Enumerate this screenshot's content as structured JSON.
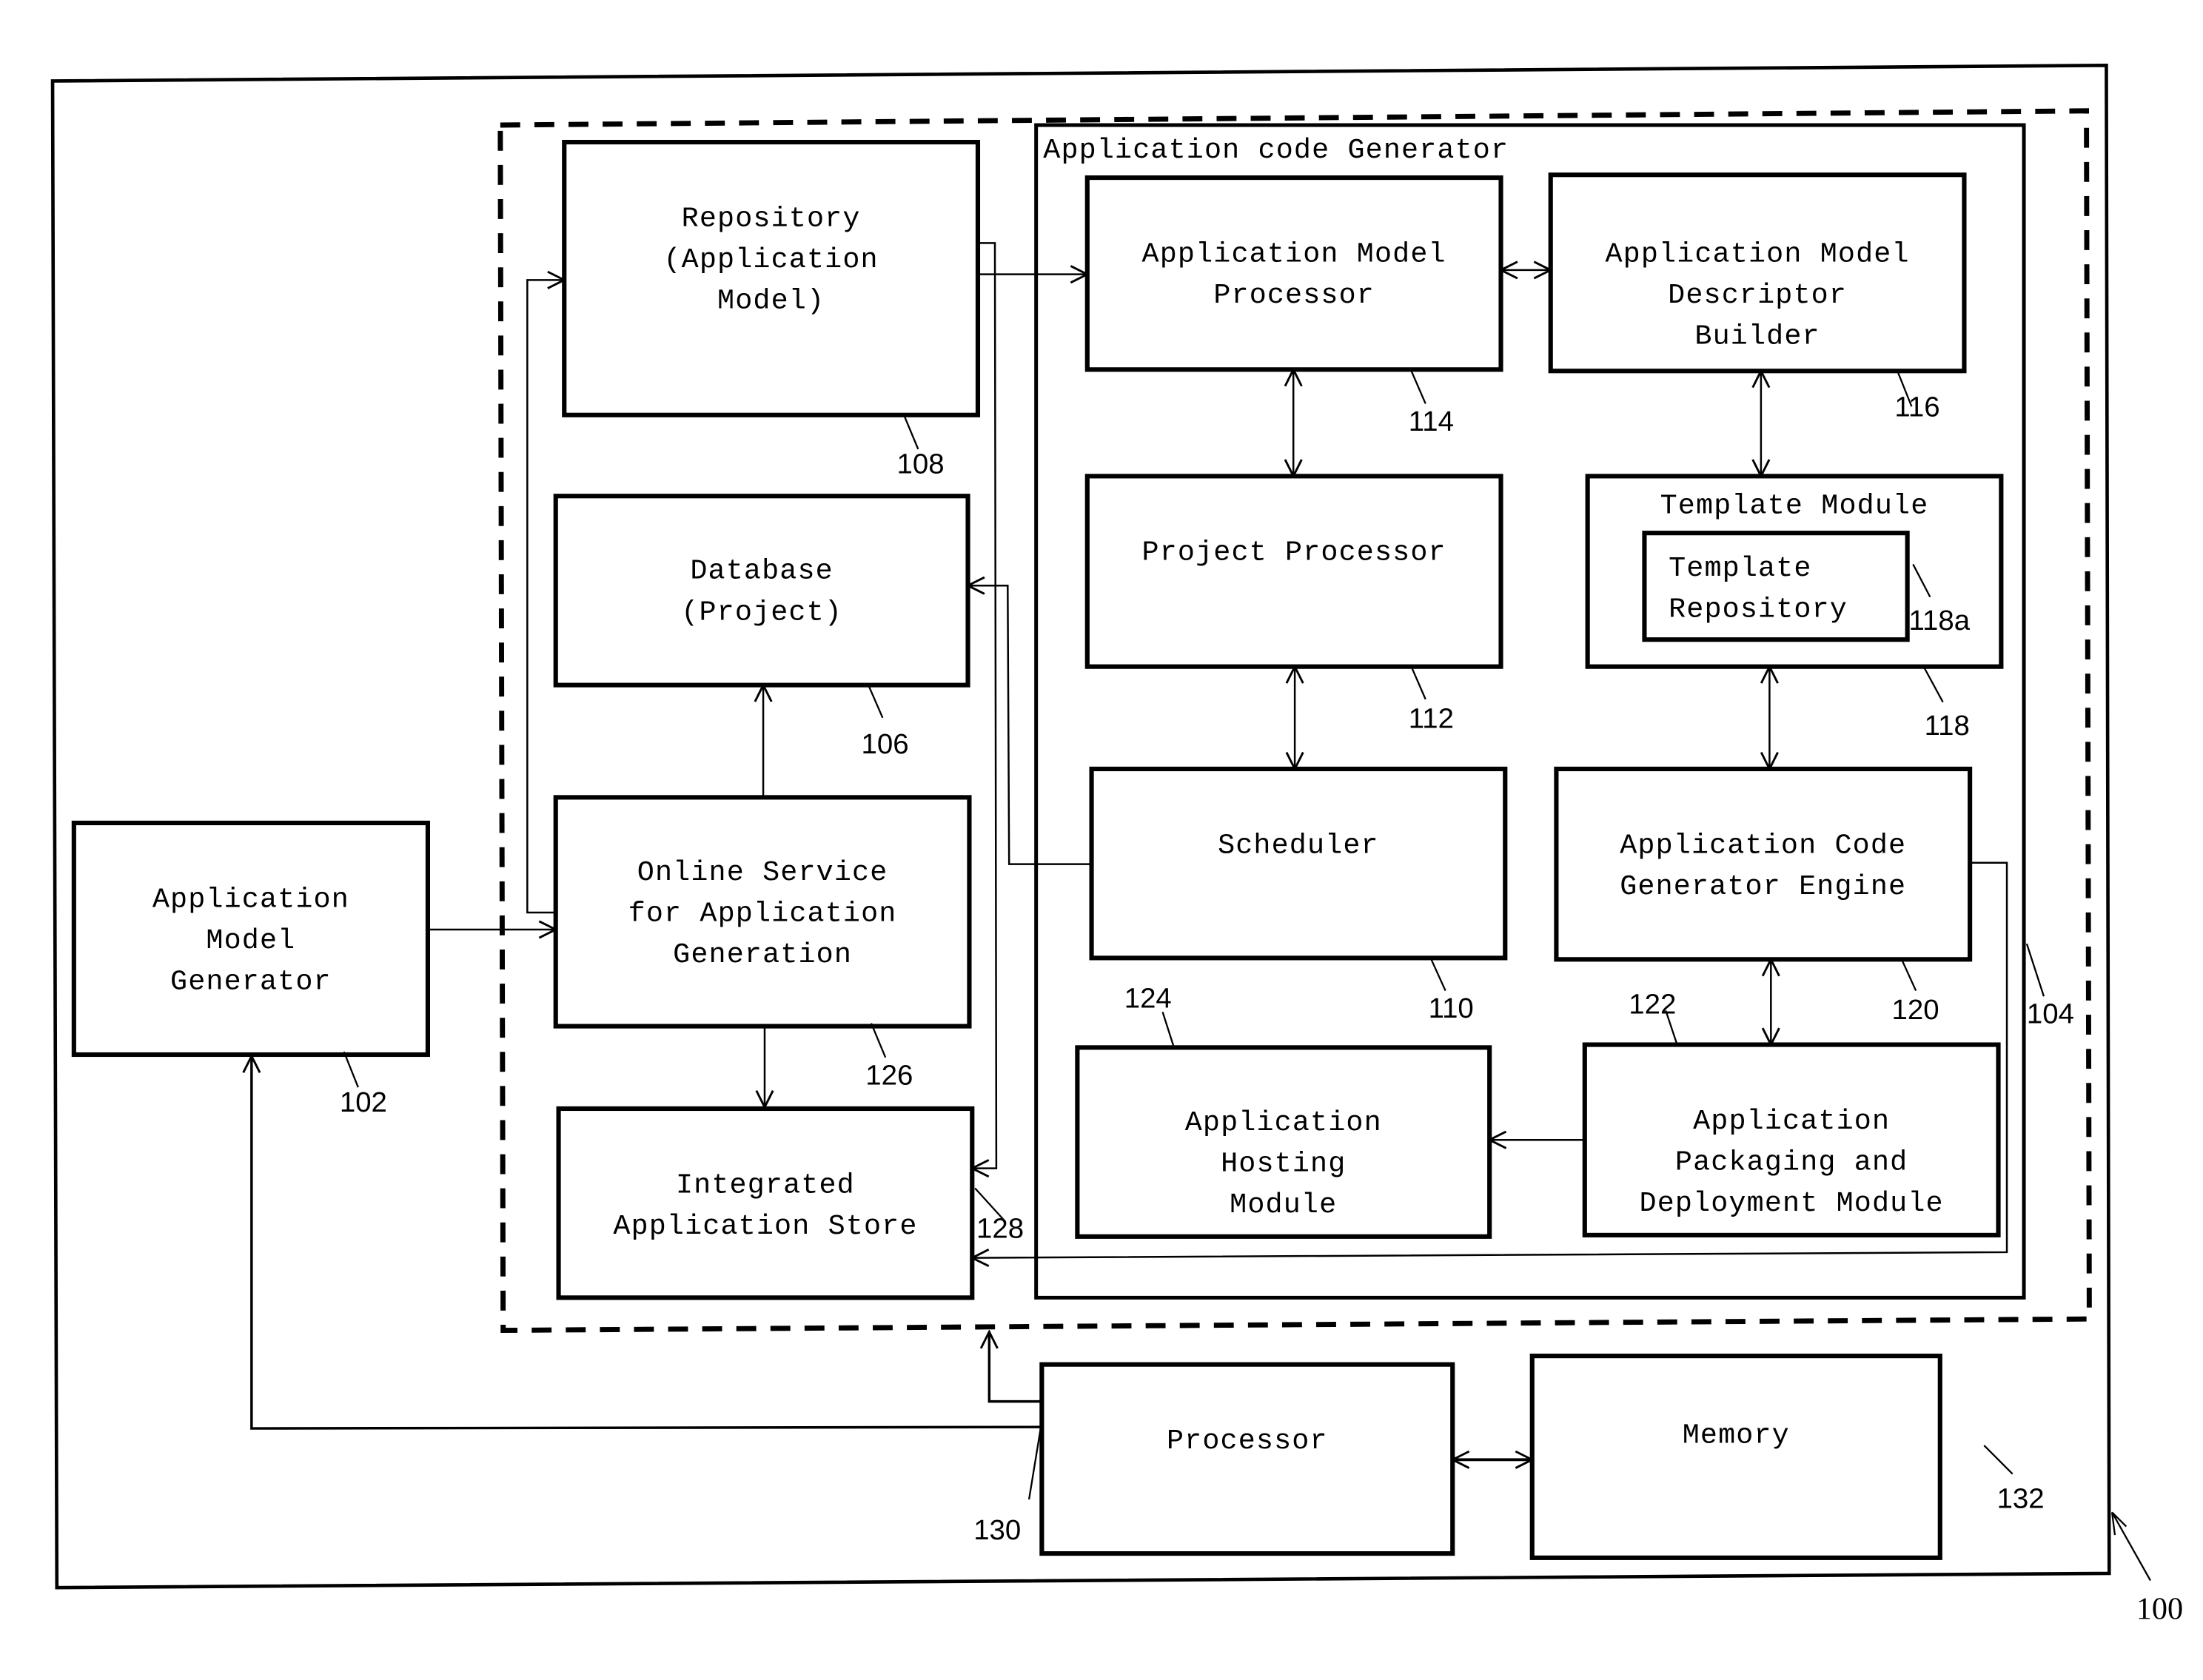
{
  "figure": {
    "system_ref": "100",
    "dashed_group_ref": "104",
    "container_label": "Application code Generator"
  },
  "blocks": {
    "app_model_generator": {
      "lines": [
        "Application",
        "Model",
        "Generator"
      ],
      "ref": "102"
    },
    "repository": {
      "lines": [
        "Repository",
        "(Application",
        "Model)"
      ],
      "ref": "108"
    },
    "database": {
      "lines": [
        "Database",
        "(Project)"
      ],
      "ref": "106"
    },
    "online_service": {
      "lines": [
        "Online Service",
        "for Application",
        "Generation"
      ],
      "ref": "126"
    },
    "app_store": {
      "lines": [
        "Integrated",
        "Application Store"
      ],
      "ref": "128"
    },
    "model_processor": {
      "lines": [
        "Application Model",
        "Processor"
      ],
      "ref": "114"
    },
    "descriptor_builder": {
      "lines": [
        "Application Model",
        "Descriptor",
        "Builder"
      ],
      "ref": "116"
    },
    "project_processor": {
      "lines": [
        "Project Processor"
      ],
      "ref": "112"
    },
    "template_module": {
      "lines": [
        "Template Module"
      ],
      "ref": "118"
    },
    "template_repository": {
      "lines": [
        "Template",
        "Repository"
      ],
      "ref": "118a"
    },
    "scheduler": {
      "lines": [
        "Scheduler"
      ],
      "ref": "110"
    },
    "code_engine": {
      "lines": [
        "Application Code",
        "Generator Engine"
      ],
      "ref": "120"
    },
    "hosting_module": {
      "lines": [
        "Application",
        "Hosting",
        "Module"
      ],
      "ref": "124"
    },
    "packaging_module": {
      "lines": [
        "Application",
        "Packaging and",
        "Deployment Module"
      ],
      "ref": "122"
    },
    "processor": {
      "lines": [
        "Processor"
      ],
      "ref": "130"
    },
    "memory": {
      "lines": [
        "Memory"
      ],
      "ref": "132"
    }
  },
  "connections": [
    {
      "from": "app_model_generator",
      "to": "online_service",
      "type": "arrow"
    },
    {
      "from": "online_service",
      "to": "repository",
      "type": "arrow"
    },
    {
      "from": "online_service",
      "to": "database",
      "type": "arrow"
    },
    {
      "from": "online_service",
      "to": "app_store",
      "type": "arrow"
    },
    {
      "from": "repository",
      "to": "model_processor",
      "type": "arrow"
    },
    {
      "from": "repository",
      "to": "app_store",
      "type": "arrow"
    },
    {
      "from": "scheduler",
      "to": "database",
      "type": "arrow"
    },
    {
      "from": "model_processor",
      "to": "descriptor_builder",
      "type": "bidirectional"
    },
    {
      "from": "model_processor",
      "to": "project_processor",
      "type": "bidirectional"
    },
    {
      "from": "project_processor",
      "to": "scheduler",
      "type": "bidirectional"
    },
    {
      "from": "descriptor_builder",
      "to": "template_module",
      "type": "bidirectional"
    },
    {
      "from": "template_module",
      "to": "code_engine",
      "type": "bidirectional"
    },
    {
      "from": "code_engine",
      "to": "packaging_module",
      "type": "bidirectional"
    },
    {
      "from": "packaging_module",
      "to": "hosting_module",
      "type": "arrow"
    },
    {
      "from": "code_engine",
      "to": "app_store",
      "type": "arrow"
    },
    {
      "from": "processor",
      "to": "memory",
      "type": "bidirectional"
    },
    {
      "from": "processor",
      "to": "app_model_generator",
      "type": "arrow"
    },
    {
      "from": "processor",
      "to": "dashed_group",
      "type": "arrow"
    }
  ]
}
